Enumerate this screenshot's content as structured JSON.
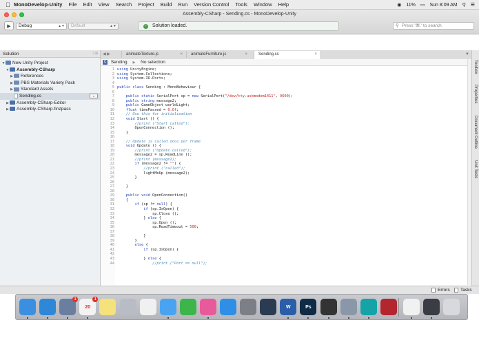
{
  "menubar": {
    "app": "MonoDevelop-Unity",
    "items": [
      "File",
      "Edit",
      "View",
      "Search",
      "Project",
      "Build",
      "Run",
      "Version Control",
      "Tools",
      "Window",
      "Help"
    ],
    "battery": "11%",
    "clock": "Sun 8:09 AM"
  },
  "window": {
    "title": "Assembly-CSharp - Sending.cs - MonoDevelop-Unity",
    "config": "Debug",
    "platform": "Default",
    "status": "Solution loaded.",
    "search_placeholder": "Press '⌘.' to search"
  },
  "solution": {
    "header": "Solution",
    "nodes": [
      {
        "label": "New Unity Project",
        "depth": 0,
        "expander": "▼",
        "icon": "solution",
        "bold": false
      },
      {
        "label": "Assembly-CSharp",
        "depth": 1,
        "expander": "▼",
        "icon": "project",
        "bold": true
      },
      {
        "label": "References",
        "depth": 2,
        "expander": "▶",
        "icon": "folder",
        "bold": false
      },
      {
        "label": "PBS Materials Variety Pack",
        "depth": 2,
        "expander": "▶",
        "icon": "folder",
        "bold": false
      },
      {
        "label": "Standard Assets",
        "depth": 2,
        "expander": "▶",
        "icon": "folder",
        "bold": false
      },
      {
        "label": "Sending.cs",
        "depth": 2,
        "expander": "",
        "icon": "file",
        "bold": false,
        "selected": true
      },
      {
        "label": "Assembly-CSharp-Editor",
        "depth": 1,
        "expander": "▶",
        "icon": "project",
        "bold": false
      },
      {
        "label": "Assembly-CSharp-firstpass",
        "depth": 1,
        "expander": "▶",
        "icon": "project",
        "bold": false
      }
    ]
  },
  "tabs": [
    {
      "label": "animateTexture.js",
      "active": false
    },
    {
      "label": "animateFurniture.js",
      "active": false
    },
    {
      "label": "Sending.cs",
      "active": true
    }
  ],
  "breadcrumb": {
    "class_name": "Sending",
    "member": "No selection"
  },
  "code_lines": [
    [
      {
        "t": "using ",
        "c": "kw"
      },
      {
        "t": "UnityEngine;"
      }
    ],
    [
      {
        "t": "using ",
        "c": "kw"
      },
      {
        "t": "System.Collections;"
      }
    ],
    [
      {
        "t": "using ",
        "c": "kw"
      },
      {
        "t": "System.IO.Ports;"
      }
    ],
    [],
    [
      {
        "t": "public class ",
        "c": "kw"
      },
      {
        "t": "Sending : MonoBehaviour {"
      }
    ],
    [],
    [
      {
        "t": "    public static ",
        "c": "kw"
      },
      {
        "t": "SerialPort sp = "
      },
      {
        "t": "new ",
        "c": "kw"
      },
      {
        "t": "SerialPort("
      },
      {
        "t": "\"/dev/tty.usbmodem1411\"",
        "c": "str"
      },
      {
        "t": ", "
      },
      {
        "t": "9600",
        "c": "nm"
      },
      {
        "t": ");"
      }
    ],
    [
      {
        "t": "    public string ",
        "c": "kw"
      },
      {
        "t": "message2;"
      }
    ],
    [
      {
        "t": "    public ",
        "c": "kw"
      },
      {
        "t": "GameObject worldLight;"
      }
    ],
    [
      {
        "t": "    float ",
        "c": "kw"
      },
      {
        "t": "timePassed = "
      },
      {
        "t": "0.0f",
        "c": "nm"
      },
      {
        "t": ";"
      }
    ],
    [
      {
        "t": "    // Use this for initialization",
        "c": "cm"
      }
    ],
    [
      {
        "t": "    void ",
        "c": "kw"
      },
      {
        "t": "Start () {"
      }
    ],
    [
      {
        "t": "        //print (\"Start called\");",
        "c": "cm"
      }
    ],
    [
      {
        "t": "        OpenConnection ();"
      }
    ],
    [
      {
        "t": "    }"
      }
    ],
    [],
    [
      {
        "t": "    // Update is called once per frame",
        "c": "cm"
      }
    ],
    [
      {
        "t": "    void ",
        "c": "kw"
      },
      {
        "t": "Update () {"
      }
    ],
    [
      {
        "t": "        //print (\"Update called\");",
        "c": "cm"
      }
    ],
    [
      {
        "t": "        message2 = sp.ReadLine ();"
      }
    ],
    [
      {
        "t": "        //print (message2);",
        "c": "cm"
      }
    ],
    [
      {
        "t": "        if ",
        "c": "kw"
      },
      {
        "t": "(message2 != "
      },
      {
        "t": "\"\"",
        "c": "str"
      },
      {
        "t": ") {"
      }
    ],
    [
      {
        "t": "            //print (\"called\");",
        "c": "cm"
      }
    ],
    [
      {
        "t": "            lightMeUp (message2);"
      }
    ],
    [
      {
        "t": "        }"
      }
    ],
    [],
    [
      {
        "t": "    }"
      }
    ],
    [],
    [
      {
        "t": "    public void ",
        "c": "kw"
      },
      {
        "t": "OpenConnection()"
      }
    ],
    [
      {
        "t": "    {"
      }
    ],
    [
      {
        "t": "        if ",
        "c": "kw"
      },
      {
        "t": "(sp != "
      },
      {
        "t": "null",
        "c": "kw"
      },
      {
        "t": ") {"
      }
    ],
    [
      {
        "t": "            if ",
        "c": "kw"
      },
      {
        "t": "(sp.IsOpen) {"
      }
    ],
    [
      {
        "t": "                sp.Close ();"
      }
    ],
    [
      {
        "t": "            } "
      },
      {
        "t": "else ",
        "c": "kw"
      },
      {
        "t": "{"
      }
    ],
    [
      {
        "t": "                sp.Open ();"
      }
    ],
    [
      {
        "t": "                sp.ReadTimeout = "
      },
      {
        "t": "500",
        "c": "nm"
      },
      {
        "t": ";"
      }
    ],
    [],
    [
      {
        "t": "            }"
      }
    ],
    [
      {
        "t": "        }"
      }
    ],
    [
      {
        "t": "        else ",
        "c": "kw"
      },
      {
        "t": "{"
      }
    ],
    [
      {
        "t": "            if ",
        "c": "kw"
      },
      {
        "t": "(sp.IsOpen) {"
      }
    ],
    [],
    [
      {
        "t": "            } "
      },
      {
        "t": "else ",
        "c": "kw"
      },
      {
        "t": "{"
      }
    ],
    [
      {
        "t": "                //print (\"Port == null\");",
        "c": "cm"
      }
    ]
  ],
  "right_pads": [
    "Toolbox",
    "Properties",
    "Document Outline",
    "Unit Tests"
  ],
  "bottom": {
    "errors": "Errors",
    "tasks": "Tasks"
  },
  "dock": {
    "apps": [
      {
        "name": "finder",
        "color": "#3b8fe0",
        "glyph": ""
      },
      {
        "name": "safari",
        "color": "#2f87d8",
        "glyph": ""
      },
      {
        "name": "preview",
        "color": "#6a7fa0",
        "glyph": "",
        "badge": "1"
      },
      {
        "name": "calendar",
        "color": "#f3f3f3",
        "glyph": "20",
        "badge": "1"
      },
      {
        "name": "notes",
        "color": "#f5e27a",
        "glyph": ""
      },
      {
        "name": "launchpad",
        "color": "#b8bcc4",
        "glyph": ""
      },
      {
        "name": "photos",
        "color": "#f0f0f0",
        "glyph": ""
      },
      {
        "name": "messages",
        "color": "#4aa3f0",
        "glyph": ""
      },
      {
        "name": "facetime",
        "color": "#3cb54a",
        "glyph": ""
      },
      {
        "name": "itunes",
        "color": "#e95a9a",
        "glyph": ""
      },
      {
        "name": "app-store",
        "color": "#2f8ee6",
        "glyph": ""
      },
      {
        "name": "system-preferences",
        "color": "#7c7f86",
        "glyph": ""
      },
      {
        "name": "steam",
        "color": "#2a3b52",
        "glyph": ""
      },
      {
        "name": "word",
        "color": "#2b5ea8",
        "glyph": "W"
      },
      {
        "name": "photoshop",
        "color": "#0f2b45",
        "glyph": "Ps"
      },
      {
        "name": "unity",
        "color": "#333333",
        "glyph": ""
      },
      {
        "name": "monodevelop",
        "color": "#8a97a8",
        "glyph": ""
      },
      {
        "name": "arduino",
        "color": "#15a3a8",
        "glyph": ""
      },
      {
        "name": "game-app",
        "color": "#b3262e",
        "glyph": ""
      },
      {
        "name": "document",
        "color": "#f1f1f1",
        "glyph": ""
      },
      {
        "name": "activity-monitor",
        "color": "#3a3d44",
        "glyph": ""
      },
      {
        "name": "trash",
        "color": "#d7d9dd",
        "glyph": ""
      }
    ]
  }
}
